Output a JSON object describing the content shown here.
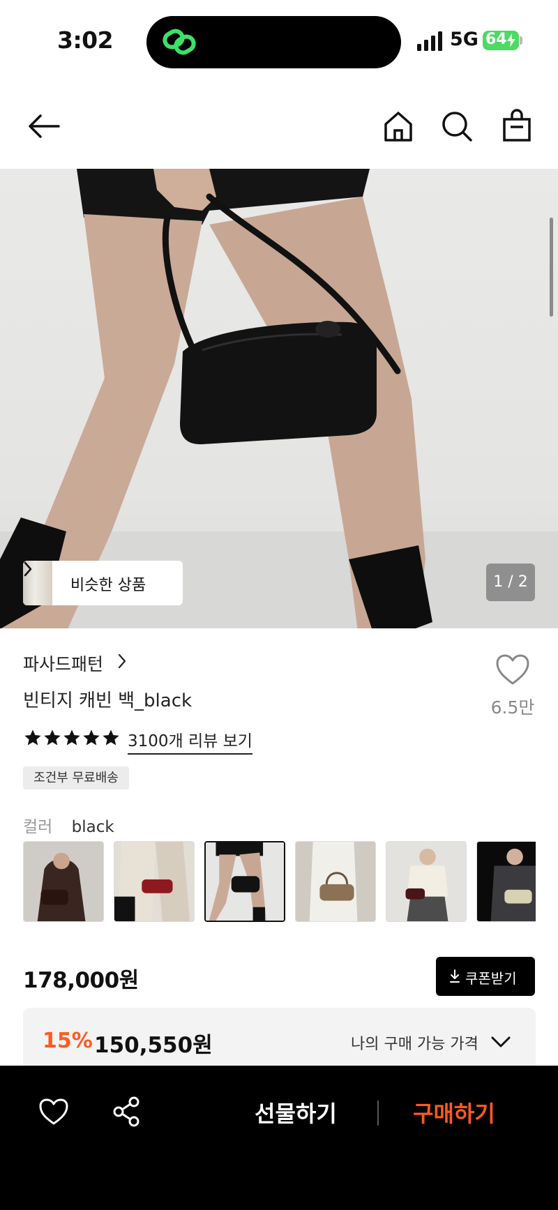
{
  "status_bar": {
    "time": "3:02",
    "network": "5G",
    "battery": "64",
    "battery_color": "#4cd964",
    "island_app_icon": "link-icon"
  },
  "nav": {
    "back_icon": "arrow-left-icon",
    "home_icon": "home-icon",
    "search_icon": "search-icon",
    "cart_icon": "shopping-bag-icon"
  },
  "hero": {
    "similar_label": "비슷한 상품",
    "page_indicator": "1 / 2"
  },
  "product": {
    "brand": "파사드패턴",
    "title": "빈티지 캐빈 백_black",
    "likes": "6.5만",
    "rating_stars": 5,
    "review_link": "3100개 리뷰 보기",
    "shipping_badge": "조건부 무료배송"
  },
  "options": {
    "color_label": "컬러",
    "color_value": "black",
    "thumbnails": [
      {
        "color": "dark brown",
        "selected": false
      },
      {
        "color": "red",
        "selected": false
      },
      {
        "color": "black",
        "selected": true
      },
      {
        "color": "beige",
        "selected": false
      },
      {
        "color": "burgundy",
        "selected": false
      },
      {
        "color": "cream",
        "selected": false
      }
    ]
  },
  "pricing": {
    "price": "178,000원",
    "coupon_label": "쿠폰받기",
    "discount_percent": "15%",
    "discount_price": "150,550원",
    "discount_note": "나의 구매 가능 가격"
  },
  "bottom_bar": {
    "gift_label": "선물하기",
    "buy_label": "구매하기",
    "accent_color": "#ff5a1f"
  }
}
